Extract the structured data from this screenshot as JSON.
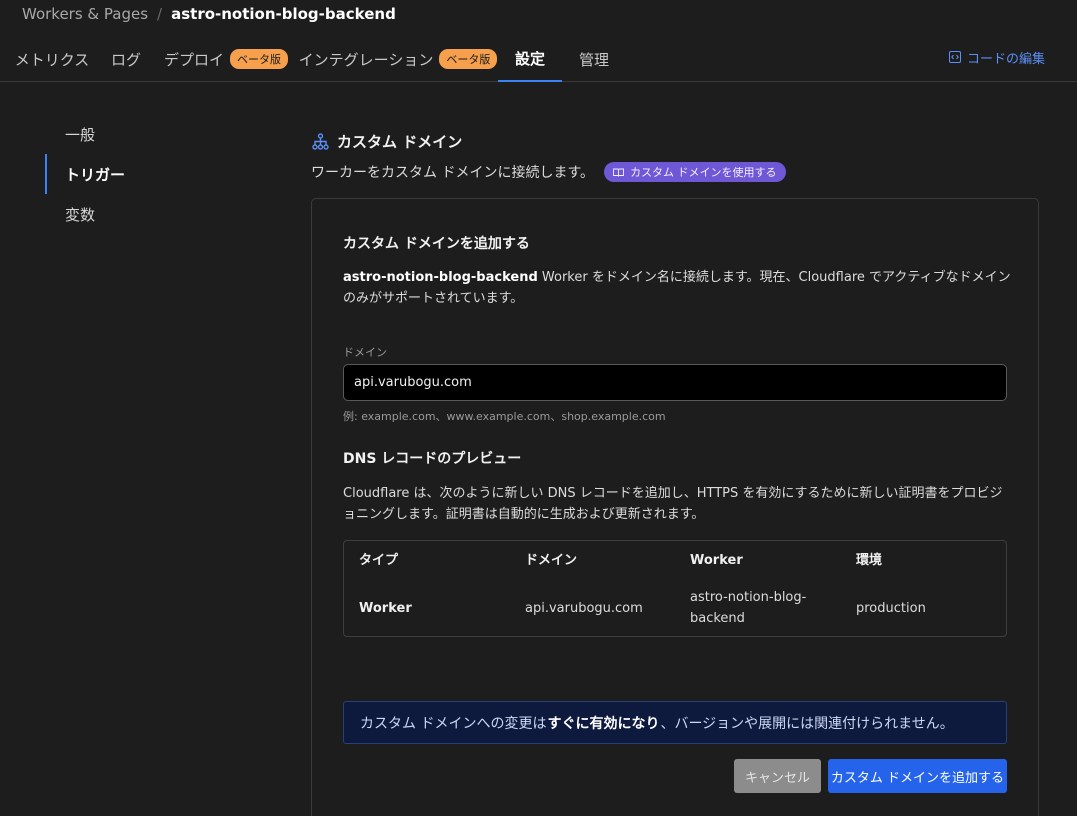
{
  "breadcrumb": {
    "root": "Workers & Pages",
    "separator": "/",
    "current": "astro-notion-blog-backend"
  },
  "tabs": [
    {
      "label": "メトリクス"
    },
    {
      "label": "ログ"
    },
    {
      "label": "デプロイ",
      "badge": "ベータ版"
    },
    {
      "label": "インテグレーション",
      "badge": "ベータ版"
    },
    {
      "label": "設定",
      "active": true
    },
    {
      "label": "管理"
    }
  ],
  "edit_code": {
    "label": "コードの編集",
    "icon": "code-editor-icon"
  },
  "sidenav": [
    {
      "label": "一般"
    },
    {
      "label": "トリガー",
      "active": true
    },
    {
      "label": "変数"
    }
  ],
  "section": {
    "icon": "network-icon",
    "title": "カスタム ドメイン",
    "description": "ワーカーをカスタム ドメインに接続します。",
    "docs_link": "カスタム ドメインを使用する"
  },
  "card": {
    "title": "カスタム ドメインを追加する",
    "desc_worker": "astro-notion-blog-backend",
    "desc_text": " Worker をドメイン名に接続します。現在、Cloudflare でアクティブなドメインのみがサポートされています。",
    "domain_label": "ドメイン",
    "domain_value": "api.varubogu.com",
    "domain_hint": "例: example.com、www.example.com、shop.example.com",
    "dns_title": "DNS レコードのプレビュー",
    "dns_desc": "Cloudflare は、次のように新しい DNS レコードを追加し、HTTPS を有効にするために新しい証明書をプロビジョニングします。証明書は自動的に生成および更新されます。",
    "table": {
      "headers": [
        "タイプ",
        "ドメイン",
        "Worker",
        "環境"
      ],
      "row": [
        "Worker",
        "api.varubogu.com",
        "astro-notion-blog-backend",
        "production"
      ]
    },
    "notice_prefix": "カスタム ドメインへの変更は",
    "notice_bold": "すぐに有効になり",
    "notice_suffix": "、バージョンや展開には関連付けられません。",
    "cancel_label": "キャンセル",
    "submit_label": "カスタム ドメインを追加する"
  },
  "colors": {
    "background": "#1d1d1d",
    "accent": "#3b82f6",
    "beta_badge": "#f6a04d",
    "docs_pill": "#6f58d6",
    "primary_button": "#2563eb",
    "notice_bg": "#0e1a3d"
  }
}
